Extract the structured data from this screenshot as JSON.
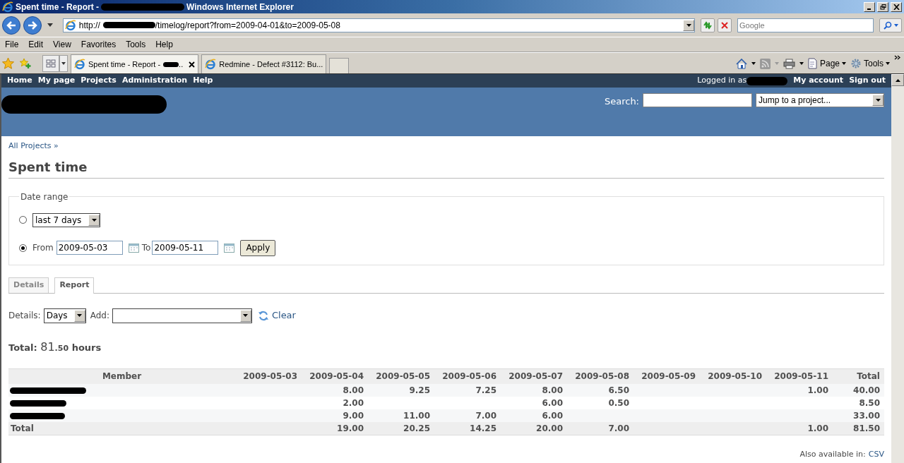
{
  "window": {
    "title_start": "Spent time - Report -",
    "title_end": "Windows Internet Explorer"
  },
  "address_bar": {
    "url_start": "http://",
    "url_end": "/timelog/report?from=2009-04-01&to=2009-05-08"
  },
  "search_box": {
    "placeholder": "Google"
  },
  "menu_bar": [
    "File",
    "Edit",
    "View",
    "Favorites",
    "Tools",
    "Help"
  ],
  "browser_tabs": [
    {
      "label": "Spent time - Report -",
      "suffix": "..",
      "selected": true
    },
    {
      "label": "Redmine - Defect #3112: Bu...",
      "selected": false
    }
  ],
  "command_bar": [
    "Page",
    "Tools"
  ],
  "top_menu": [
    "Home",
    "My page",
    "Projects",
    "Administration",
    "Help"
  ],
  "account": {
    "logged_in_label": "Logged in as",
    "links": [
      "My account",
      "Sign out"
    ]
  },
  "header": {
    "search_label": "Search:",
    "jump_select": "Jump to a project..."
  },
  "breadcrumb": "All Projects »",
  "heading": "Spent time",
  "date_range": {
    "legend": "Date range",
    "options": [
      {
        "kind": "period",
        "selected": false,
        "value": "last 7 days"
      },
      {
        "kind": "from_to",
        "selected": true,
        "from_label": "From",
        "from": "2009-05-03",
        "to_label": "To",
        "to": "2009-05-11"
      }
    ],
    "apply": "Apply"
  },
  "tabs": [
    {
      "label": "Details",
      "selected": false
    },
    {
      "label": "Report",
      "selected": true
    }
  ],
  "criteria": {
    "details_label": "Details:",
    "details_value": "Days",
    "add_label": "Add:",
    "clear": "Clear"
  },
  "total": {
    "label": "Total:",
    "hours_whole": "81",
    "hours_fraction": ".50",
    "unit": "hours"
  },
  "table": {
    "columns": [
      "Member",
      "2009-05-03",
      "2009-05-04",
      "2009-05-05",
      "2009-05-06",
      "2009-05-07",
      "2009-05-08",
      "2009-05-09",
      "2009-05-10",
      "2009-05-11",
      "Total"
    ],
    "rows": [
      {
        "cells": [
          null,
          null,
          "8.00",
          "9.25",
          "7.25",
          "8.00",
          "6.50",
          null,
          null,
          "1.00",
          "40.00"
        ]
      },
      {
        "cells": [
          null,
          null,
          "2.00",
          null,
          null,
          "6.00",
          "0.50",
          null,
          null,
          null,
          "8.50"
        ]
      },
      {
        "cells": [
          null,
          null,
          "9.00",
          "11.00",
          "7.00",
          "6.00",
          null,
          null,
          null,
          null,
          "33.00"
        ]
      }
    ],
    "total_row": {
      "cells": [
        "Total",
        null,
        "19.00",
        "20.25",
        "14.25",
        "20.00",
        "7.00",
        null,
        null,
        "1.00",
        "81.50"
      ]
    }
  },
  "footer": {
    "label": "Also available in:",
    "link": "CSV"
  }
}
